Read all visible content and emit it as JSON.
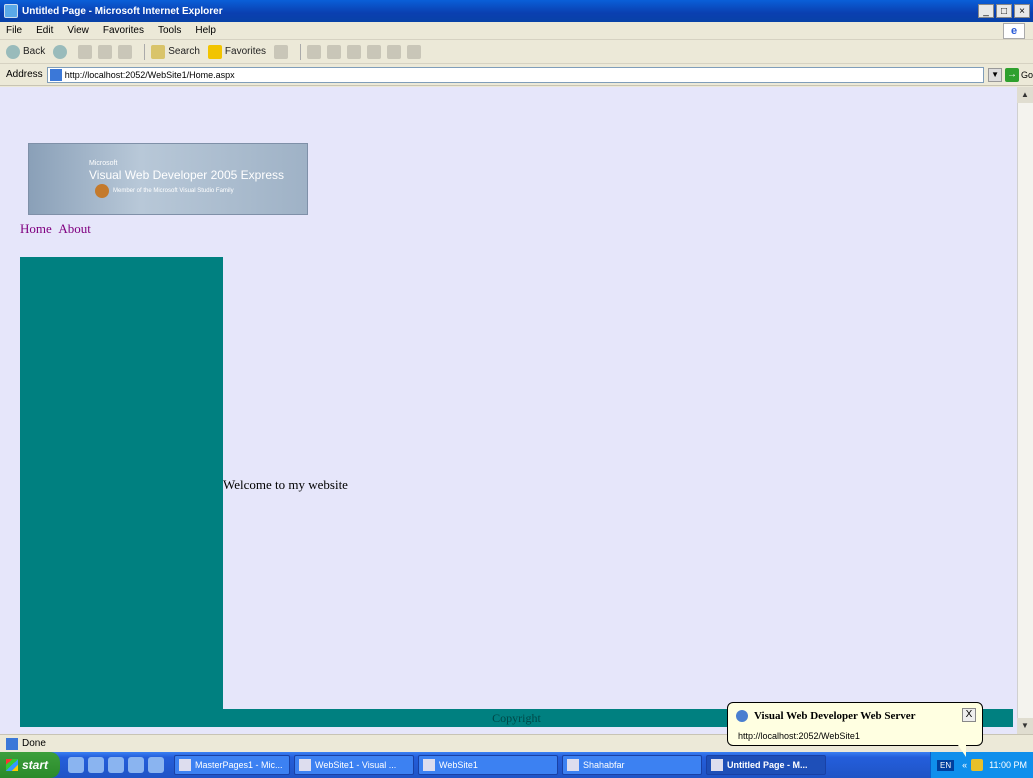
{
  "window": {
    "title": "Untitled Page - Microsoft Internet Explorer",
    "min": "_",
    "max": "□",
    "close": "×"
  },
  "menu": [
    "File",
    "Edit",
    "View",
    "Favorites",
    "Tools",
    "Help"
  ],
  "toolbar": {
    "back_label": "Back",
    "search_label": "Search",
    "favorites_label": "Favorites"
  },
  "address": {
    "label": "Address",
    "url": "http://localhost:2052/WebSite1/Home.aspx",
    "go_label": "Go"
  },
  "page": {
    "logo": {
      "ms": "Microsoft",
      "product": "Visual Web Developer 2005 Express",
      "tagline": "Member of the Microsoft Visual Studio Family"
    },
    "nav": {
      "home": "Home",
      "about": "About"
    },
    "content": "Welcome to my website",
    "footer": "Copyright",
    "colors": {
      "background": "#e6e6fa",
      "sidebar": "#008080",
      "link": "#800080"
    }
  },
  "status": {
    "text": "Done"
  },
  "taskbar": {
    "start": "start",
    "tasks": [
      "MasterPages1 - Mic...",
      "WebSite1 - Visual ...",
      "WebSite1",
      "Shahabfar",
      "Untitled Page - M..."
    ],
    "lang": "EN",
    "clock": "11:00 PM"
  },
  "balloon": {
    "title": "Visual Web Developer Web Server",
    "url": "http://localhost:2052/WebSite1",
    "close": "X"
  }
}
